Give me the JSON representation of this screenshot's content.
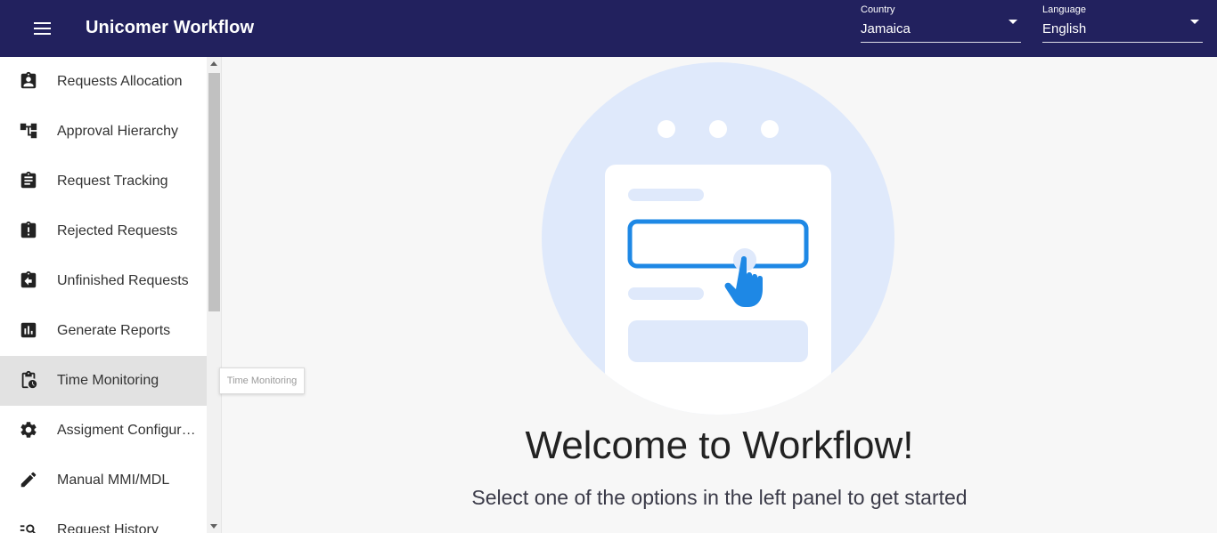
{
  "app": {
    "title": "Unicomer Workflow",
    "header_color": "#22215e"
  },
  "country": {
    "label": "Country",
    "value": "Jamaica"
  },
  "language": {
    "label": "Language",
    "value": "English"
  },
  "sidebar": {
    "items": [
      {
        "label": "Requests Allocation",
        "icon": "assignment-ind-icon"
      },
      {
        "label": "Approval Hierarchy",
        "icon": "account-tree-icon"
      },
      {
        "label": "Request Tracking",
        "icon": "assignment-icon"
      },
      {
        "label": "Rejected Requests",
        "icon": "assignment-late-icon"
      },
      {
        "label": "Unfinished Requests",
        "icon": "assignment-return-icon"
      },
      {
        "label": "Generate Reports",
        "icon": "assessment-icon"
      },
      {
        "label": "Time Monitoring",
        "icon": "pending-actions-icon",
        "active": true
      },
      {
        "label": "Assigment Configuration",
        "icon": "settings-icon"
      },
      {
        "label": "Manual MMI/MDL",
        "icon": "edit-icon"
      },
      {
        "label": "Request History",
        "icon": "manage-search-icon"
      }
    ]
  },
  "tooltip": {
    "text": "Time Monitoring"
  },
  "main": {
    "welcome": "Welcome to Workflow!",
    "subtitle": "Select one of the options in the left panel to get started",
    "accent_color": "#1e88e5",
    "illustration_bg": "#dfe9fb"
  }
}
